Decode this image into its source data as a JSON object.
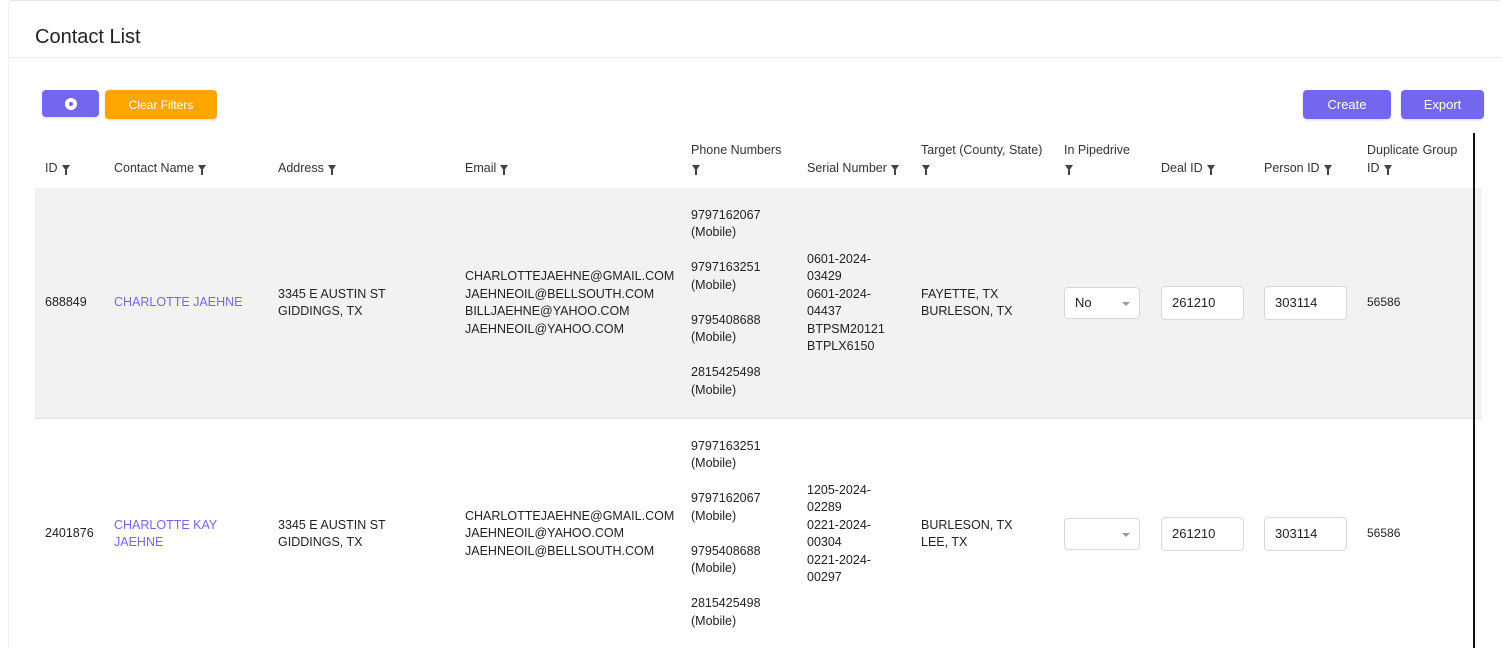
{
  "page": {
    "title": "Contact List"
  },
  "toolbar": {
    "clear_filters_label": "Clear Filters",
    "create_label": "Create",
    "export_label": "Export",
    "settings_icon": "gear-icon"
  },
  "colors": {
    "accent": "#7367f0",
    "warning": "#ffa500",
    "row_highlight": "#f2f2f2"
  },
  "table": {
    "headers": {
      "id": "ID",
      "contact_name": "Contact Name",
      "address": "Address",
      "email": "Email",
      "phone_numbers": "Phone Numbers",
      "serial_number": "Serial Number",
      "target": "Target (County, State)",
      "in_pipedrive": "In Pipedrive",
      "deal_id": "Deal ID",
      "person_id": "Person ID",
      "duplicate_group_id": "Duplicate Group ID"
    },
    "rows": [
      {
        "id": "688849",
        "contact_name": "CHARLOTTE JAEHNE",
        "address": "3345 E AUSTIN ST\nGIDDINGS, TX",
        "email": "CHARLOTTEJAEHNE@GMAIL.COM\nJAEHNEOIL@BELLSOUTH.COM\nBILLJAEHNE@YAHOO.COM\nJAEHNEOIL@YAHOO.COM",
        "phones": "9797162067\n(Mobile)\n\n9797163251\n(Mobile)\n\n9795408688\n(Mobile)\n\n2815425498\n(Mobile)",
        "serial_numbers": "0601-2024-\n03429\n0601-2024-\n04437\nBTPSM20121\nBTPLX6150",
        "target": "FAYETTE, TX\nBURLESON, TX",
        "in_pipedrive": "No",
        "deal_id": "261210",
        "person_id": "303114",
        "duplicate_group_id": "56586"
      },
      {
        "id": "2401876",
        "contact_name": "CHARLOTTE KAY\nJAEHNE",
        "address": "3345 E AUSTIN ST\nGIDDINGS, TX",
        "email": "CHARLOTTEJAEHNE@GMAIL.COM\nJAEHNEOIL@YAHOO.COM\nJAEHNEOIL@BELLSOUTH.COM",
        "phones": "9797163251\n(Mobile)\n\n9797162067\n(Mobile)\n\n9795408688\n(Mobile)\n\n2815425498\n(Mobile)",
        "serial_numbers": "1205-2024-\n02289\n0221-2024-\n00304\n0221-2024-\n00297",
        "target": "BURLESON, TX\nLEE, TX",
        "in_pipedrive": "",
        "deal_id": "261210",
        "person_id": "303114",
        "duplicate_group_id": "56586"
      }
    ]
  }
}
